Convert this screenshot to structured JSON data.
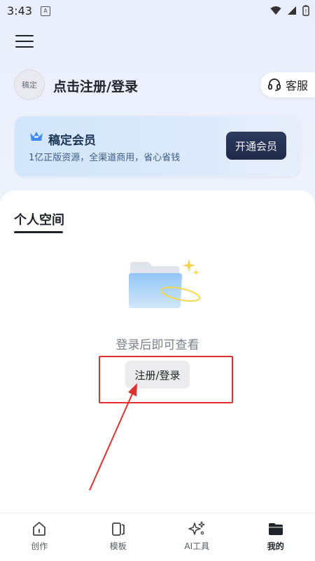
{
  "status": {
    "time": "3:43",
    "notif_glyph": "A"
  },
  "header": {
    "menu_icon": "menu-icon"
  },
  "profile": {
    "avatar_text": "稿定",
    "login_prompt": "点击注册/登录",
    "service_label": "客服"
  },
  "vip": {
    "title": "稿定会员",
    "desc": "1亿正版资源，全渠道商用，省心省钱",
    "button": "开通会员",
    "accent": "#1f2a4a"
  },
  "personal": {
    "tab": "个人空间",
    "empty_text": "登录后即可查看",
    "register_button": "注册/登录"
  },
  "annotation": {
    "color": "#e03030"
  },
  "nav": {
    "items": [
      {
        "label": "创作",
        "icon": "home-icon"
      },
      {
        "label": "模板",
        "icon": "template-icon"
      },
      {
        "label": "AI工具",
        "icon": "sparkle-icon"
      },
      {
        "label": "我的",
        "icon": "folder-icon"
      }
    ]
  }
}
